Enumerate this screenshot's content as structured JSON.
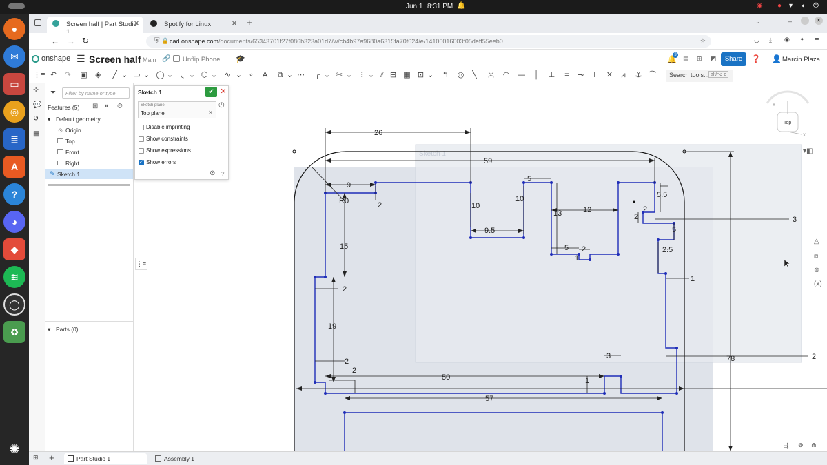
{
  "system": {
    "date": "Jun 1",
    "time": "8:31 PM"
  },
  "browser": {
    "tabs": [
      {
        "label": "Screen half | Part Studio 1"
      },
      {
        "label": "Spotify for Linux"
      }
    ],
    "url_host": "cad.onshape.com",
    "url_path": "/documents/65343701f27f086b323a01d7/w/cb4b97a9680a6315fa70f624/e/14106016003f05deff55eeb0"
  },
  "onshape": {
    "logo": "onshape",
    "doc_title": "Screen half",
    "branch": "Main",
    "link_label": "Unflip Phone",
    "notif_count": "3",
    "share_label": "Share",
    "user_name": "Marcin Plaza",
    "search_tools": "Search tools...",
    "search_shortcut": "alt/⌥ c"
  },
  "tree": {
    "filter_placeholder": "Filter by name or type",
    "features_label": "Features (5)",
    "default_geometry": "Default geometry",
    "items": [
      "Origin",
      "Top",
      "Front",
      "Right"
    ],
    "sketch": "Sketch 1",
    "parts_label": "Parts (0)"
  },
  "sketch_panel": {
    "title": "Sketch 1",
    "plane_caption": "Sketch plane",
    "plane_value": "Top plane",
    "options": [
      {
        "label": "Disable imprinting",
        "checked": false
      },
      {
        "label": "Show constraints",
        "checked": false
      },
      {
        "label": "Show expressions",
        "checked": false
      },
      {
        "label": "Show errors",
        "checked": true
      }
    ]
  },
  "viewcube": {
    "face": "Top",
    "axis_y": "Y",
    "axis_x": "X"
  },
  "dimensions": {
    "d26": "26",
    "d59": "59",
    "d9": "9",
    "r10": "R0",
    "d2a": "2",
    "d10a": "10",
    "d9_5": "9.5",
    "d10b": "10",
    "d5a": "5",
    "d13": "13",
    "d12": "12",
    "d5b": "5",
    "d2b": "2",
    "d1a": "1",
    "d5_5": "5.5",
    "d2c": "2",
    "d2d": "2",
    "d3": "3",
    "d5c": "5",
    "d2_5": "2.5",
    "d1b": "1",
    "d15": "15",
    "d2e": "2",
    "d19": "19",
    "d2f": "2",
    "d2g": "2",
    "d50": "50",
    "d1c": "1",
    "d3b": "3",
    "d78": "78",
    "d2h": "2",
    "d57": "57"
  },
  "bottom": {
    "tab1": "Part Studio 1",
    "tab2": "Assembly 1"
  },
  "colors": {
    "accent": "#1a73c4",
    "sketch": "#1f2db8",
    "confirm": "#2c9b3f",
    "cancel": "#d9342b"
  }
}
